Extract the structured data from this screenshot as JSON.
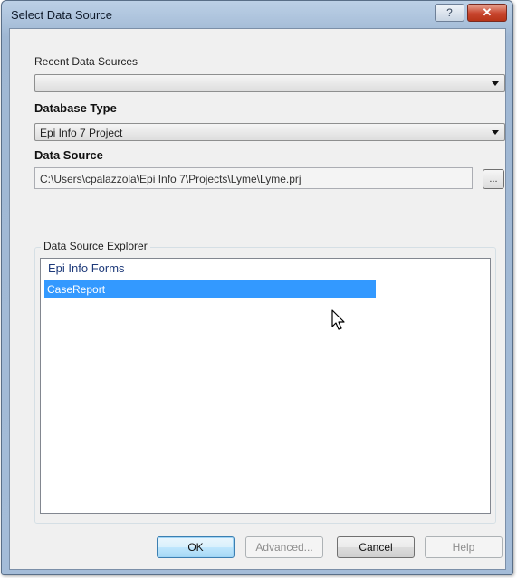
{
  "window": {
    "title": "Select Data Source",
    "help_glyph": "?",
    "close_glyph": "✕"
  },
  "recent": {
    "label": "Recent Data Sources",
    "value": ""
  },
  "database_type": {
    "label": "Database Type",
    "value": "Epi Info 7 Project"
  },
  "data_source": {
    "label": "Data Source",
    "value": "C:\\Users\\cpalazzola\\Epi Info 7\\Projects\\Lyme\\Lyme.prj",
    "browse_label": "..."
  },
  "explorer": {
    "group_label": "Data Source Explorer",
    "list_header": "Epi Info Forms",
    "items": [
      "CaseReport"
    ],
    "selected_index": 0
  },
  "buttons": {
    "ok": "OK",
    "advanced": "Advanced...",
    "cancel": "Cancel",
    "help": "Help"
  },
  "colors": {
    "selection": "#3399ff",
    "list_header": "#1e3a7a",
    "close_button": "#c8452e"
  },
  "icons": {
    "cursor": "mouse-pointer-icon",
    "dropdown": "chevron-down-icon",
    "close": "close-icon",
    "help": "help-icon"
  }
}
